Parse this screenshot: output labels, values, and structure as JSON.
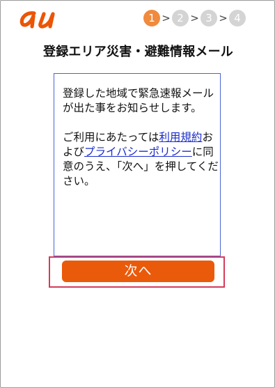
{
  "header": {
    "logo_text": "au",
    "steps": [
      "1",
      "2",
      "3",
      "4"
    ],
    "active_step": 1,
    "separator": ">"
  },
  "page": {
    "title": "登録エリア災害・避難情報メール"
  },
  "content": {
    "description": "登録した地域で緊急速報メールが出た事をお知らせします。",
    "consent_prefix": "ご利用にあたっては",
    "terms_link": "利用規約",
    "consent_and": "および",
    "privacy_link": "プライバシーポリシー",
    "consent_suffix": "に同意のうえ、「次へ」を押してください。"
  },
  "actions": {
    "next_label": "次へ"
  },
  "colors": {
    "brand": "#EB5505",
    "active_step": "#F08A3D",
    "inactive_step": "#D4D4D4",
    "link": "#1A2CCC",
    "box_border": "#4A63D6",
    "highlight": "#D63A5A"
  }
}
